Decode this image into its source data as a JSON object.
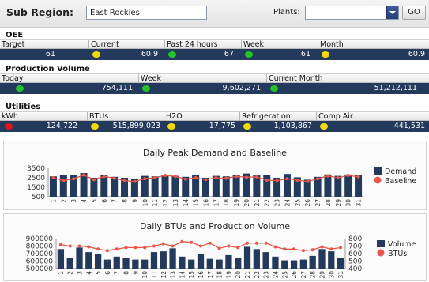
{
  "header": {
    "sub_region_label": "Sub Region:",
    "sub_region_value": "East Rockies",
    "plants_label": "Plants:",
    "plants_value": "",
    "go_label": "GO"
  },
  "oee": {
    "title": "OEE",
    "headers": [
      "Target",
      "Current",
      "Past 24 hours",
      "Week",
      "Month"
    ],
    "values": [
      {
        "value": "61",
        "status": ""
      },
      {
        "value": "60.9",
        "status": "yellow"
      },
      {
        "value": "67",
        "status": "green"
      },
      {
        "value": "61",
        "status": "green"
      },
      {
        "value": "60.9",
        "status": "yellow"
      }
    ]
  },
  "production": {
    "title": "Production Volume",
    "headers": [
      "Today",
      "Week",
      "Current Month"
    ],
    "values": [
      {
        "value": "754,111",
        "status": "green"
      },
      {
        "value": "9,602,271",
        "status": "green"
      },
      {
        "value": "51,212,111",
        "status": "green"
      }
    ]
  },
  "utilities": {
    "title": "Utilities",
    "headers": [
      "kWh",
      "BTUs",
      "H2O",
      "Refrigeration",
      "Comp Air"
    ],
    "values": [
      {
        "value": "124,722",
        "status": "red"
      },
      {
        "value": "515,899,023",
        "status": "yellow"
      },
      {
        "value": "17,775",
        "status": "yellow"
      },
      {
        "value": "1,103,867",
        "status": "yellow"
      },
      {
        "value": "441,531",
        "status": "yellow"
      }
    ]
  },
  "colors": {
    "bar": "#243a5c",
    "line": "#e8584a",
    "status_green": "#23c42a",
    "status_yellow": "#f2d90a",
    "status_red": "#e2141a"
  },
  "chart_data": [
    {
      "type": "bar",
      "title": "Daily Peak Demand and Baseline",
      "categories": [
        "1",
        "2",
        "3",
        "4",
        "5",
        "6",
        "7",
        "8",
        "9",
        "10",
        "11",
        "12",
        "13",
        "14",
        "15",
        "16",
        "17",
        "18",
        "19",
        "20",
        "21",
        "22",
        "23",
        "24",
        "25",
        "26",
        "27",
        "28",
        "29",
        "30",
        "31"
      ],
      "series": [
        {
          "name": "Demand",
          "kind": "bar",
          "values": [
            2650,
            2750,
            2800,
            3000,
            2500,
            2750,
            2600,
            2500,
            2400,
            2700,
            2650,
            2800,
            2700,
            2600,
            2750,
            2500,
            2700,
            2650,
            2800,
            2950,
            2750,
            2800,
            2500,
            2900,
            2550,
            2300,
            2600,
            2850,
            2700,
            2850,
            2750
          ]
        },
        {
          "name": "Baseline",
          "kind": "line",
          "values": [
            2500,
            2200,
            2400,
            2800,
            2300,
            2650,
            2450,
            2200,
            2100,
            2400,
            2500,
            2750,
            2650,
            2350,
            2500,
            2300,
            2500,
            2450,
            2650,
            2550,
            2600,
            2250,
            2200,
            2400,
            2250,
            2100,
            2400,
            2700,
            2500,
            2750,
            2600
          ]
        }
      ],
      "ylim": [
        500,
        3500
      ],
      "yticks": [
        "3500",
        "2500",
        "1500",
        "500"
      ],
      "legend": "right"
    },
    {
      "type": "bar",
      "title": "Daily BTUs and Production Volume",
      "categories": [
        "1",
        "2",
        "3",
        "4",
        "5",
        "6",
        "7",
        "8",
        "9",
        "10",
        "11",
        "12",
        "13",
        "14",
        "15",
        "16",
        "17",
        "18",
        "19",
        "20",
        "21",
        "22",
        "23",
        "24",
        "25",
        "26",
        "27",
        "28",
        "29",
        "30",
        "31"
      ],
      "series": [
        {
          "name": "Volume",
          "kind": "bar",
          "axis": "left",
          "values": [
            760000,
            640000,
            780000,
            720000,
            690000,
            620000,
            660000,
            640000,
            620000,
            620000,
            720000,
            730000,
            770000,
            660000,
            620000,
            700000,
            630000,
            620000,
            680000,
            640000,
            790000,
            760000,
            720000,
            660000,
            610000,
            610000,
            620000,
            670000,
            760000,
            730000,
            640000
          ]
        },
        {
          "name": "BTUs",
          "kind": "line",
          "axis": "right",
          "values": [
            720,
            700,
            700,
            690,
            660,
            640,
            660,
            680,
            680,
            680,
            700,
            730,
            700,
            760,
            750,
            700,
            740,
            670,
            700,
            680,
            740,
            740,
            740,
            690,
            660,
            660,
            640,
            650,
            690,
            660,
            680
          ]
        }
      ],
      "ylim_left": [
        500000,
        900000
      ],
      "ylim_right": [
        400,
        800
      ],
      "yticks_left": [
        "900000",
        "800000",
        "700000",
        "600000",
        "500000"
      ],
      "yticks_right": [
        "800",
        "700",
        "600",
        "500",
        "400"
      ],
      "legend": "right"
    }
  ]
}
